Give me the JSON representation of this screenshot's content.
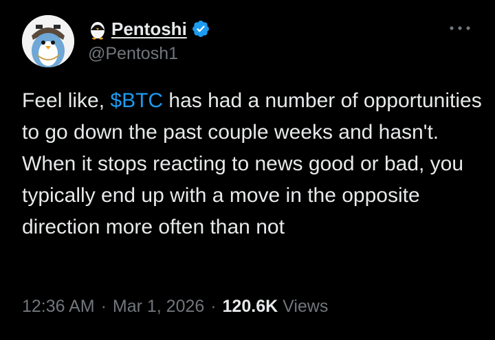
{
  "author": {
    "display_name": "Pentoshi",
    "handle": "@Pentosh1",
    "emoji_icon": "penguin-emoji",
    "verified": true,
    "verified_color": "#1d9bf0"
  },
  "menu": {
    "icon": "more-horizontal-icon"
  },
  "tweet": {
    "text_before": "Feel like, ",
    "cashtag": "$BTC",
    "text_after": " has had a number of opportunities to go down the past couple weeks and hasn't. When it stops reacting to news good or bad, you typically end up with a move in the opposite direction more often than not"
  },
  "meta": {
    "time": "12:36 AM",
    "separator": "·",
    "date": "Mar 1, 2026",
    "views_count": "120.6K",
    "views_label": "Views"
  },
  "colors": {
    "background": "#000000",
    "text": "#e7e9ea",
    "secondary": "#71767b",
    "link": "#1d9bf0"
  }
}
